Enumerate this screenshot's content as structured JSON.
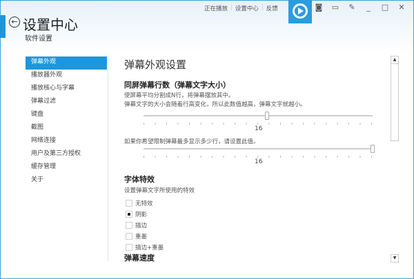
{
  "header": {
    "title": "设置中心",
    "subtitle": "软件设置",
    "links": [
      "正在播放",
      "设置中心",
      "反馈"
    ],
    "window_icons": [
      "camera-icon",
      "miniplayer-icon",
      "pin-icon",
      "minimize-icon",
      "maximize-icon",
      "close-icon"
    ],
    "window_glyphs": [
      "◙",
      "▭",
      "✎",
      "_",
      "□",
      "✕"
    ]
  },
  "sidebar": {
    "items": [
      "弹幕外观",
      "播放器外观",
      "播放核心与字幕",
      "弹幕过滤",
      "键盘",
      "截图",
      "网络连接",
      "用户及第三方授权",
      "缓存管理",
      "关于"
    ],
    "active": 0
  },
  "main": {
    "title": "弹幕外观设置",
    "lines_section": {
      "heading": "同屏弹幕行数（弹幕文字大小）",
      "desc1": "使屏幕平均分割成N行，将弹幕摆放其中。",
      "desc2": "弹幕文字的大小会随着行高变化，所以此数值越高，弹幕文字就越小。",
      "slider1_value": "16",
      "slider1_fraction": 0.54,
      "limit_desc": "如果你希望限制弹幕最多显示多少行，请设置此值。",
      "slider2_value": "16",
      "slider2_fraction": 1.0
    },
    "font_section": {
      "heading": "字体特效",
      "desc": "设置弹幕文字所使用的特效",
      "options": [
        "无特效",
        "阴影",
        "描边",
        "重墨",
        "描边+重墨"
      ],
      "selected": 1
    },
    "speed_heading": "弹幕速度"
  },
  "colors": {
    "accent": "#1e96dc"
  }
}
